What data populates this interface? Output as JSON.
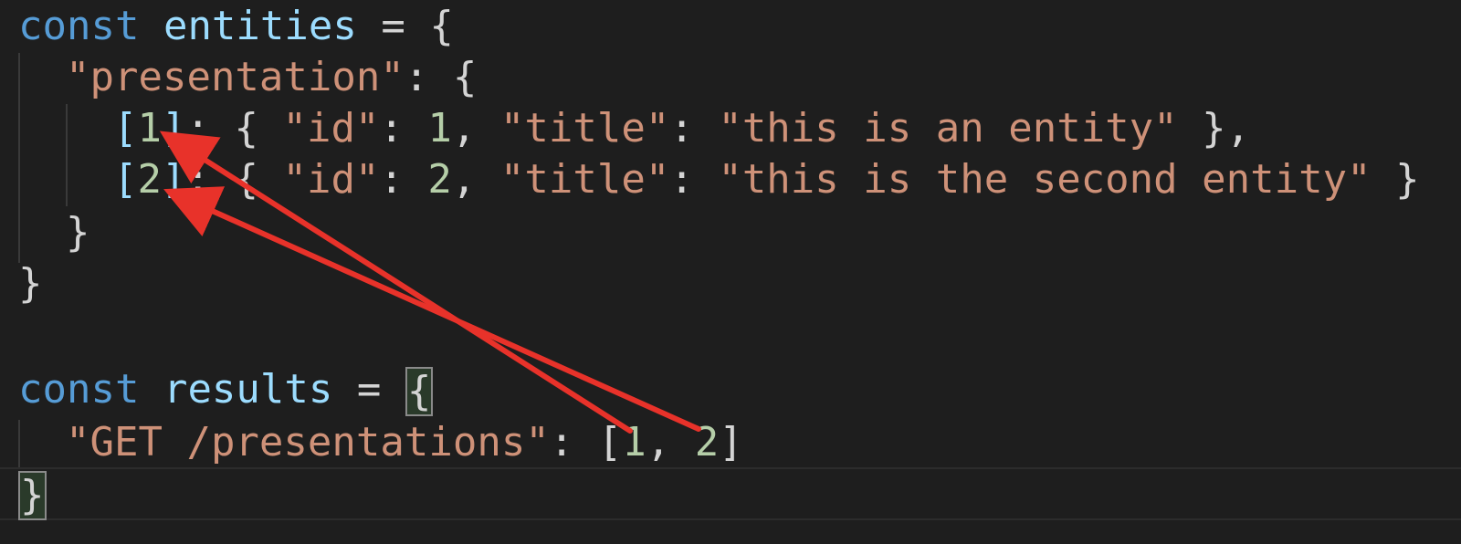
{
  "code": {
    "line1": {
      "kw": "const",
      "name": "entities",
      "op": " = {"
    },
    "line2": {
      "key": "\"presentation\"",
      "rest": ": {"
    },
    "line3": {
      "bopen": "[",
      "index": "1",
      "bclose": "]",
      "p1": ": { ",
      "k1": "\"id\"",
      "p2": ": ",
      "v1": "1",
      "p3": ", ",
      "k2": "\"title\"",
      "p4": ": ",
      "v2": "\"this is an entity\"",
      "p5": " },"
    },
    "line4": {
      "bopen": "[",
      "index": "2",
      "bclose": "]",
      "p1": ": { ",
      "k1": "\"id\"",
      "p2": ": ",
      "v1": "2",
      "p3": ", ",
      "k2": "\"title\"",
      "p4": ": ",
      "v2": "\"this is the second entity\"",
      "p5": " }"
    },
    "line5": {
      "text": "}"
    },
    "line6": {
      "text": "}"
    },
    "line7": {
      "kw": "const",
      "name": "results",
      "op": " = ",
      "brace": "{"
    },
    "line8": {
      "key": "\"GET /presentations\"",
      "p1": ": [",
      "v1": "1",
      "p2": ", ",
      "v2": "2",
      "p3": "]"
    },
    "line9": {
      "brace": "}"
    }
  },
  "colors": {
    "background": "#1e1e1e",
    "keyword": "#569cd6",
    "variable": "#9cdcfe",
    "string": "#ce9178",
    "number": "#b5cea8",
    "annotation_arrow": "#e8322a"
  }
}
